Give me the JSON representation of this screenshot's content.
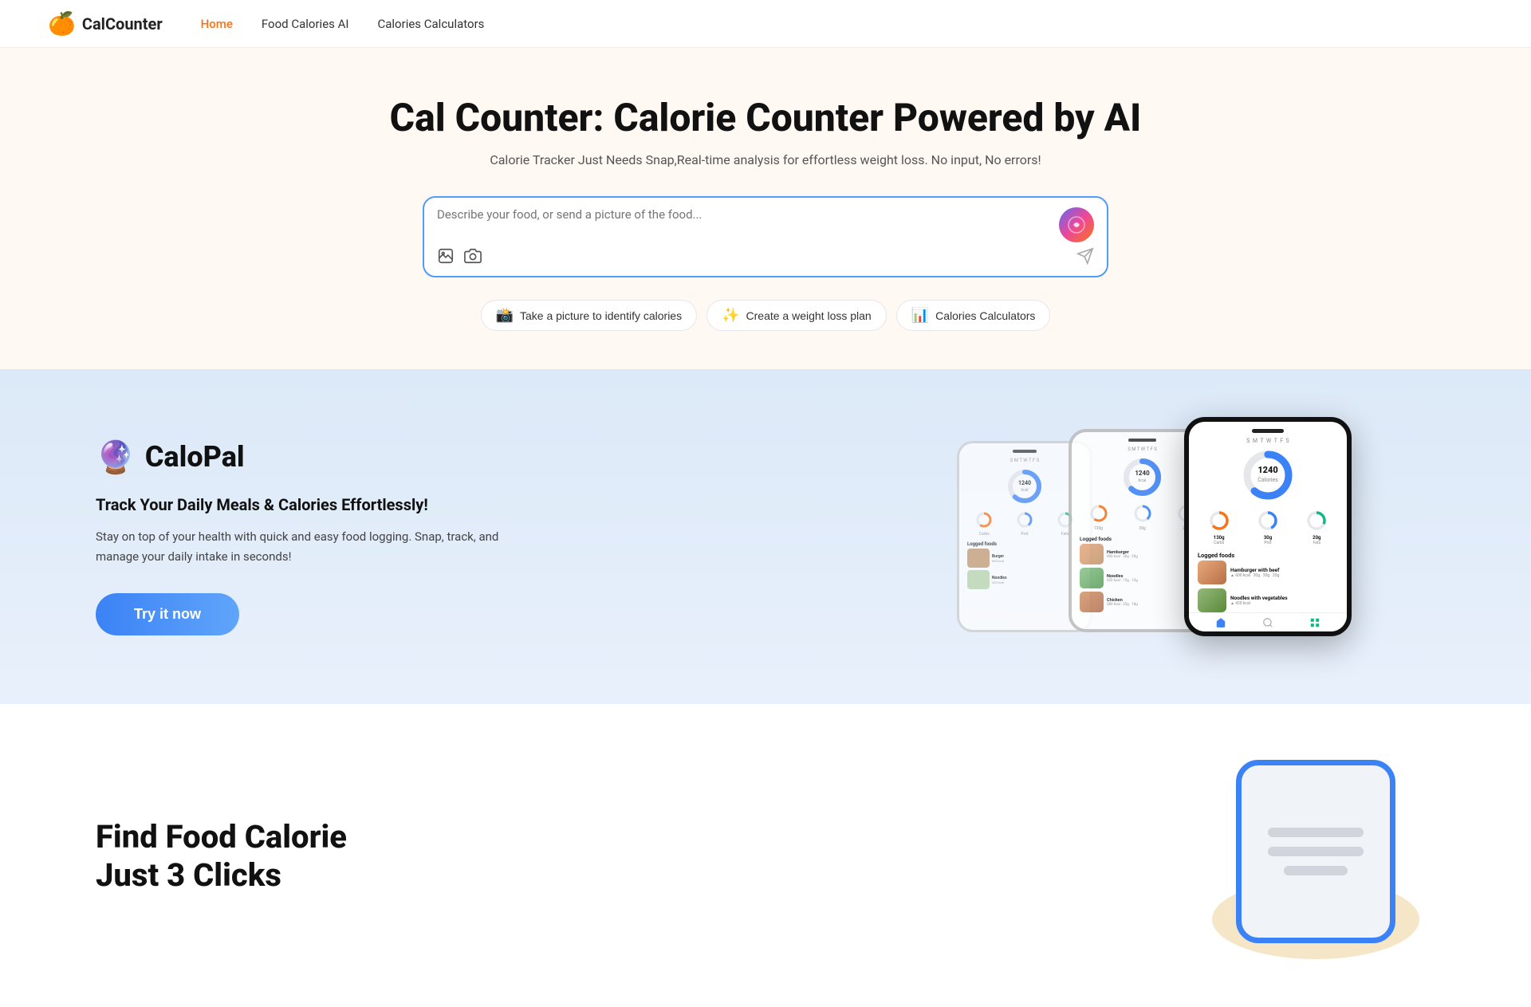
{
  "nav": {
    "logo_icon": "🍊",
    "logo_text": "CalCounter",
    "links": [
      {
        "label": "Home",
        "active": true
      },
      {
        "label": "Food Calories AI",
        "active": false
      },
      {
        "label": "Calories Calculators",
        "active": false
      }
    ]
  },
  "hero": {
    "title": "Cal Counter: Calorie Counter Powered by AI",
    "subtitle": "Calorie Tracker Just Needs Snap,Real-time analysis for effortless weight loss. No input, No errors!",
    "search_placeholder": "Describe your food, or send a picture of the food...",
    "quick_actions": [
      {
        "label": "Take a picture to identify calories",
        "icon": "📸"
      },
      {
        "label": "Create a weight loss plan",
        "icon": "✨"
      },
      {
        "label": "Calories Calculators",
        "icon": "📊"
      }
    ]
  },
  "calopal": {
    "brand_icon": "🔮",
    "brand_name": "CaloPal",
    "tagline": "Track Your Daily Meals & Calories Effortlessly!",
    "description": "Stay on top of your health with quick and easy food logging. Snap, track, and manage your daily intake in seconds!",
    "try_btn_label": "Try it now",
    "phone_data": {
      "calories": "1240",
      "calories_label": "Calories",
      "macros": [
        {
          "value": "130g",
          "label": "Carbs"
        },
        {
          "value": "30g",
          "label": "Prot"
        },
        {
          "value": "20g",
          "label": "Fats"
        }
      ],
      "foods": [
        {
          "name": "Hamburger with beef",
          "meta": "600 kcal · 30g · 30g · 20g",
          "color": "#e8a87c"
        },
        {
          "name": "Noodles with vegetables",
          "meta": "420 kcal",
          "color": "#b8d4a8"
        },
        {
          "name": "Chicken leg",
          "meta": "380 kcal",
          "color": "#c4956a"
        }
      ]
    }
  },
  "find_food": {
    "title": "Find Food Calorie",
    "subtitle": "Just 3 Clicks"
  }
}
